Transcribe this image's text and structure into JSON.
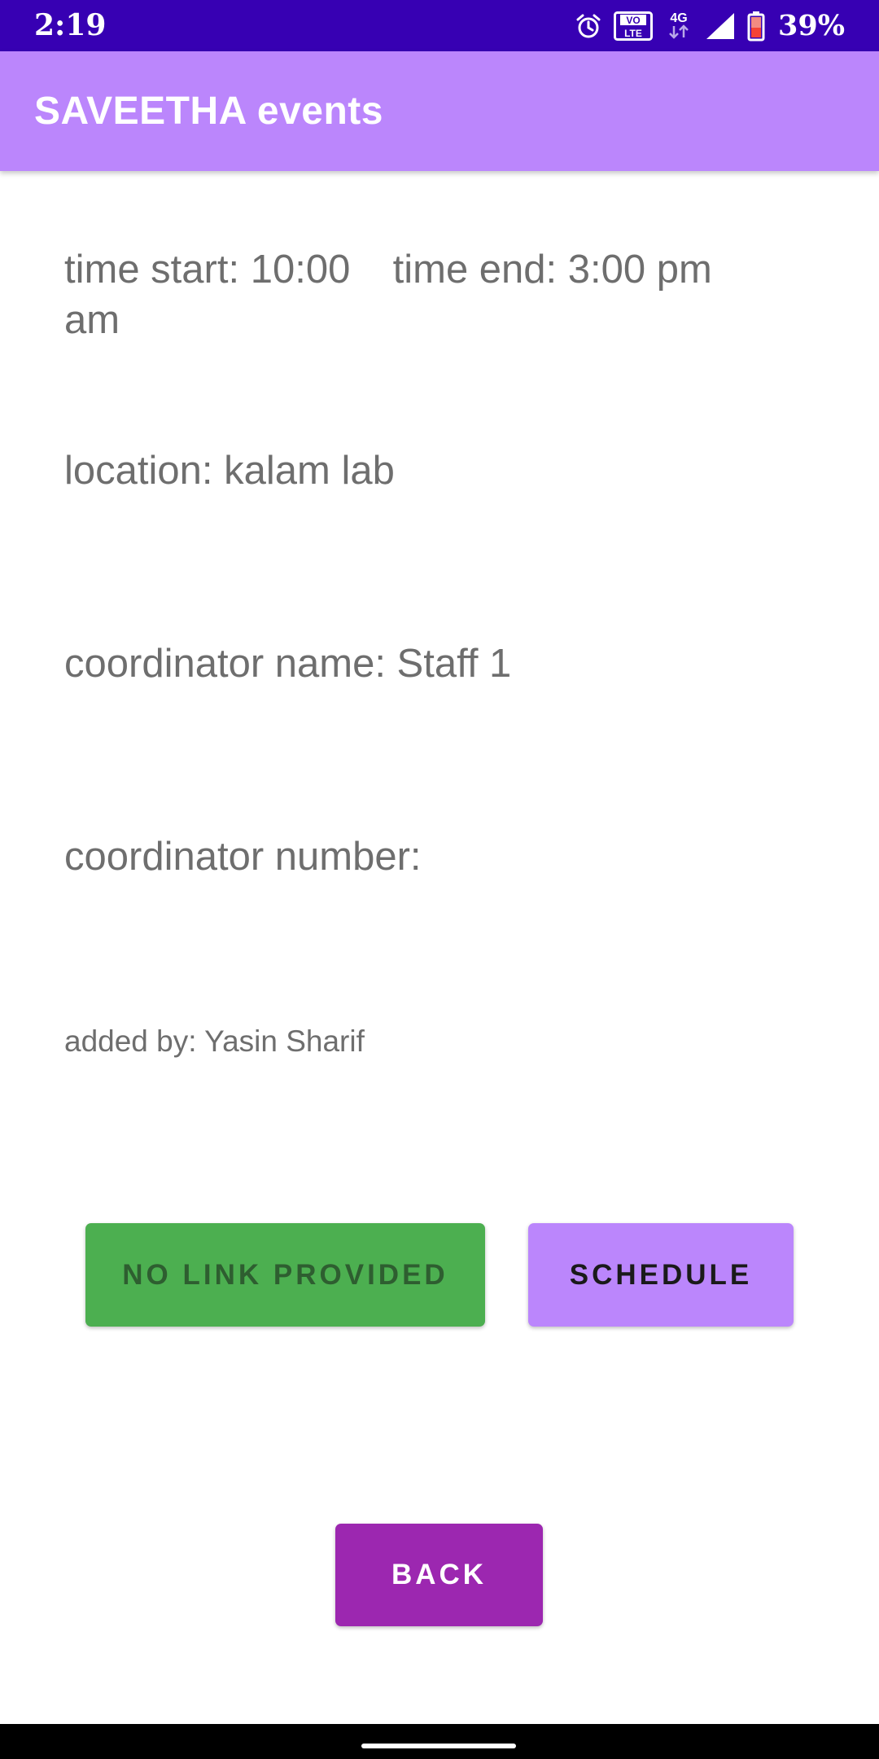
{
  "status_bar": {
    "time": "2:19",
    "battery_percent": "39%",
    "network_label": "4G",
    "volte_label": "VO LTE",
    "icons": [
      "alarm-icon",
      "volte-icon",
      "network-4g-icon",
      "signal-icon",
      "battery-icon"
    ]
  },
  "app_bar": {
    "title": "SAVEETHA events",
    "color": "#bb86fc"
  },
  "event": {
    "time_start": "time start: 10:00",
    "time_start_suffix": "am",
    "time_end": "time end: 3:00 pm",
    "location": "location: kalam lab",
    "coordinator_name": "coordinator name: Staff 1",
    "coordinator_number": "coordinator number:",
    "added_by": "added by: Yasin Sharif"
  },
  "buttons": {
    "no_link": "NO LINK PROVIDED",
    "schedule": "SCHEDULE",
    "back": "BACK"
  },
  "colors": {
    "status_bar": "#3700b3",
    "no_link_button": "#4caf50",
    "schedule_button": "#bb86fc",
    "back_button": "#9c27b0"
  }
}
